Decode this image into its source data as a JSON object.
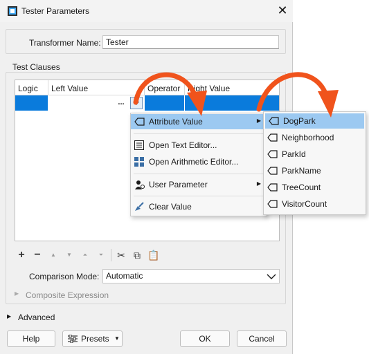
{
  "window": {
    "title": "Tester Parameters"
  },
  "transformer": {
    "label": "Transformer Name:",
    "value": "Tester"
  },
  "test_clauses": {
    "label": "Test Clauses",
    "columns": [
      "Logic",
      "Left Value",
      "Operator",
      "Right Value"
    ],
    "ellipsis": "..."
  },
  "comparison_mode": {
    "label": "Comparison Mode:",
    "value": "Automatic"
  },
  "composite_expression": {
    "label": "Composite Expression"
  },
  "advanced": {
    "label": "Advanced"
  },
  "buttons": {
    "help": "Help",
    "presets": "Presets",
    "ok": "OK",
    "cancel": "Cancel"
  },
  "context_menu": {
    "items": [
      {
        "label": "Attribute Value",
        "icon": "attribute-icon",
        "highlighted": true,
        "submenu": true
      },
      {
        "label": "Open Text Editor...",
        "icon": "text-editor-icon"
      },
      {
        "label": "Open Arithmetic Editor...",
        "icon": "calculator-icon"
      },
      {
        "label": "User Parameter",
        "icon": "user-parameter-icon",
        "submenu": true
      },
      {
        "label": "Clear Value",
        "icon": "broom-icon"
      }
    ]
  },
  "attribute_submenu": {
    "items": [
      "DogPark",
      "Neighborhood",
      "ParkId",
      "ParkName",
      "TreeCount",
      "VisitorCount"
    ]
  },
  "colors": {
    "selection": "#0a7bdc",
    "menu_highlight": "#9cc9f1",
    "annotation_arrow": "#f0531c"
  }
}
